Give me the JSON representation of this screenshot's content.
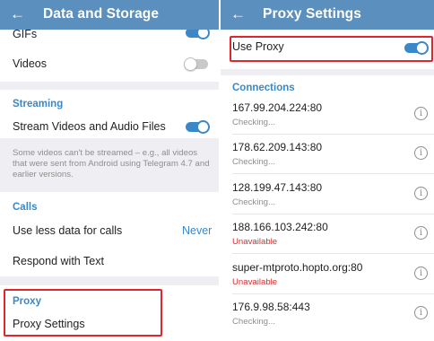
{
  "left": {
    "title": "Data and Storage",
    "gifs_label": "GIFs",
    "videos_label": "Videos",
    "streaming": {
      "header": "Streaming",
      "stream_label": "Stream Videos and Audio Files",
      "note": "Some videos can't be streamed – e.g., all videos that were sent from Android using Telegram 4.7 and earlier versions."
    },
    "calls": {
      "header": "Calls",
      "less_data_label": "Use less data for calls",
      "less_data_value": "Never",
      "respond_label": "Respond with Text"
    },
    "proxy": {
      "header": "Proxy",
      "settings_label": "Proxy Settings"
    },
    "toggles": {
      "gifs": true,
      "videos": false,
      "stream": true
    }
  },
  "right": {
    "title": "Proxy Settings",
    "use_proxy_label": "Use Proxy",
    "use_proxy_on": true,
    "connections_header": "Connections",
    "proxies": [
      {
        "address": "167.99.204.224:80",
        "status": "Checking...",
        "error": false
      },
      {
        "address": "178.62.209.143:80",
        "status": "Checking...",
        "error": false
      },
      {
        "address": "128.199.47.143:80",
        "status": "Checking...",
        "error": false
      },
      {
        "address": "188.166.103.242:80",
        "status": "Unavailable",
        "error": true
      },
      {
        "address": "super-mtproto.hopto.org:80",
        "status": "Unavailable",
        "error": true
      },
      {
        "address": "176.9.98.58:443",
        "status": "Checking...",
        "error": false
      }
    ]
  },
  "icons": {
    "back": "arrow-left-icon",
    "info": "info-icon"
  },
  "colors": {
    "appbar": "#5b8fbe",
    "accent": "#3a88c8",
    "highlight": "#e0262d",
    "error": "#d32f2f"
  }
}
